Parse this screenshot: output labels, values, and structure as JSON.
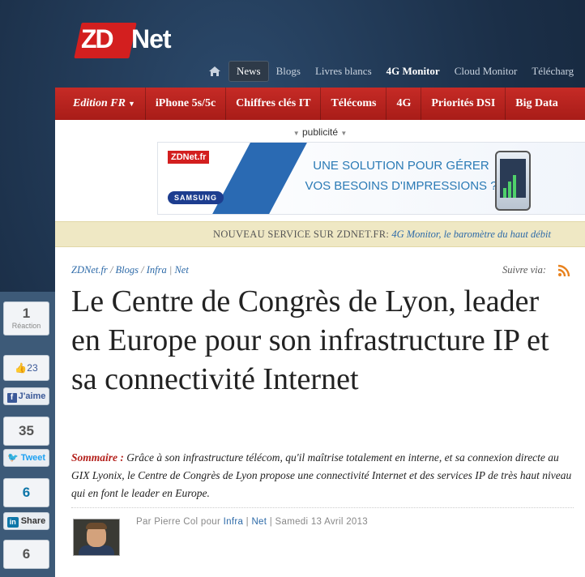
{
  "brand": {
    "logo_left": "ZD",
    "logo_right": "Net"
  },
  "topnav": {
    "items": [
      {
        "label": "News",
        "active": true
      },
      {
        "label": "Blogs"
      },
      {
        "label": "Livres blancs"
      },
      {
        "label": "4G Monitor",
        "bold": true
      },
      {
        "label": "Cloud Monitor"
      },
      {
        "label": "Télécharg"
      }
    ]
  },
  "catbar": {
    "edition": "Edition FR",
    "items": [
      "iPhone 5s/5c",
      "Chiffres clés IT",
      "Télécoms",
      "4G",
      "Priorités DSI",
      "Big Data"
    ]
  },
  "ad": {
    "label": "publicité",
    "brand_small": "ZDNet.fr",
    "partner": "SAMSUNG",
    "line1": "UNE SOLUTION POUR GÉRER",
    "line2": "VOS BESOINS D'IMPRESSIONS ?"
  },
  "notice": {
    "label": "NOUVEAU SERVICE SUR ZDNET.FR:",
    "link": "4G Monitor, le baromètre du haut débit"
  },
  "breadcrumb": {
    "items": [
      "ZDNet.fr",
      "Blogs",
      "Infra",
      "Net"
    ],
    "separators": [
      "/",
      "/",
      "|"
    ]
  },
  "follow": {
    "label": "Suivre via:"
  },
  "article": {
    "title": "Le Centre de Congrès de Lyon, leader en Europe pour son infrastructure IP et sa connectivité Internet",
    "summary_label": "Sommaire :",
    "summary": "Grâce à son infrastructure télécom, qu'il maîtrise totalement en interne, et sa connexion directe au GIX Lyonix, le Centre de Congrès de Lyon propose une connectivité Internet et des services IP de très haut niveau qui en font le leader en Europe.",
    "byline_prefix": "Par Pierre Col pour",
    "byline_cat1": "Infra",
    "byline_sep": "|",
    "byline_cat2": "Net",
    "byline_date": "| Samedi 13 Avril 2013"
  },
  "share": {
    "reactions_count": "1",
    "reactions_label": "Réaction",
    "like_count": "23",
    "like_label": "J'aime",
    "tweet_count": "35",
    "tweet_label": "Tweet",
    "linkedin_count": "6",
    "linkedin_label": "Share",
    "gplus_count": "6"
  }
}
